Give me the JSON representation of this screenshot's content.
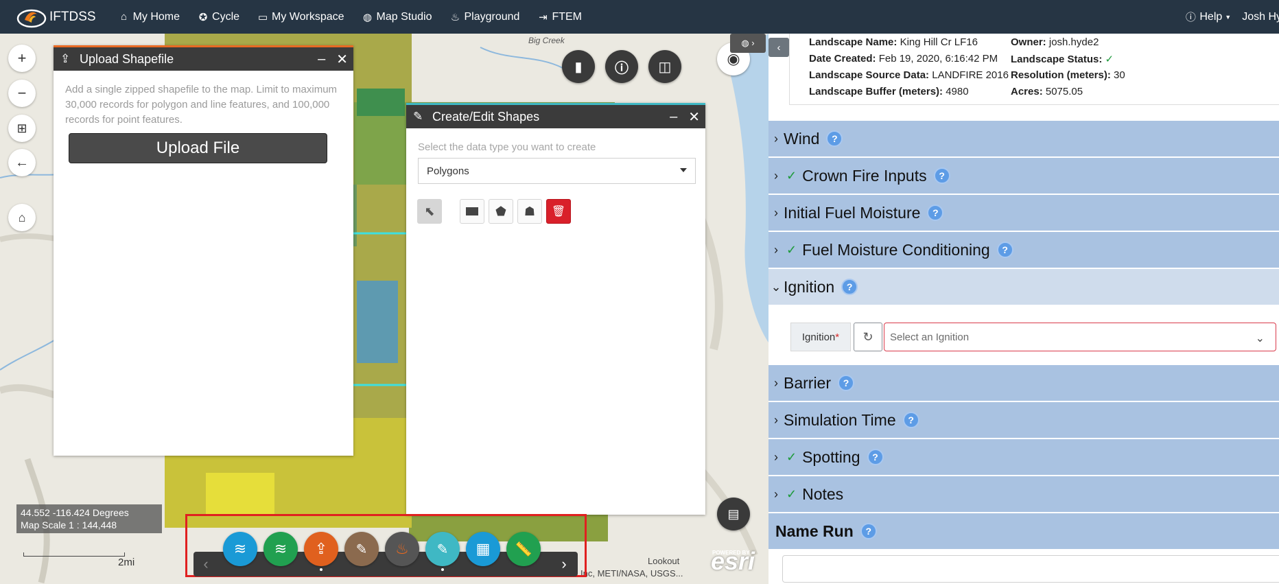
{
  "nav": {
    "brand": "IFTDSS",
    "items": [
      {
        "label": "My Home",
        "icon": "home-icon"
      },
      {
        "label": "Cycle",
        "icon": "cycle-icon"
      },
      {
        "label": "My Workspace",
        "icon": "workspace-icon"
      },
      {
        "label": "Map Studio",
        "icon": "globe-icon"
      },
      {
        "label": "Playground",
        "icon": "fire-icon"
      },
      {
        "label": "FTEM",
        "icon": "export-icon"
      }
    ],
    "help": "Help",
    "user": "Josh Hy"
  },
  "map": {
    "coords": "44.552 -116.424 Degrees",
    "scale": "Map Scale 1 : 144,448",
    "scale_bar_label": "2mi",
    "attribution": "Inc, METI/NASA, USGS...",
    "esri": "esri",
    "esri_sub": "POWERED BY",
    "place_labels": [
      "Big Creek",
      "Lookout"
    ]
  },
  "upload_panel": {
    "title": "Upload Shapefile",
    "description": "Add a single zipped shapefile to the map. Limit to maximum 30,000 records for polygon and line features, and 100,000 records for point features.",
    "button": "Upload File"
  },
  "edit_panel": {
    "title": "Create/Edit Shapes",
    "label": "Select the data type you want to create",
    "selected": "Polygons"
  },
  "toolbar": {
    "buttons": [
      {
        "name": "layers-button",
        "color": "#1a9ad6"
      },
      {
        "name": "add-layer-button",
        "color": "#21a050"
      },
      {
        "name": "upload-button",
        "color": "#e0601e"
      },
      {
        "name": "edit-button",
        "color": "#8b6a4e"
      },
      {
        "name": "fire-button",
        "color": "#555555"
      },
      {
        "name": "draw-button",
        "color": "#3fb8c4"
      },
      {
        "name": "grid-button",
        "color": "#1a9ad6"
      },
      {
        "name": "measure-button",
        "color": "#21a050"
      }
    ]
  },
  "landscape": {
    "name_label": "Landscape Name:",
    "name_value": "King Hill Cr LF16",
    "owner_label": "Owner:",
    "owner_value": "josh.hyde2",
    "created_label": "Date Created:",
    "created_value": "Feb 19, 2020, 6:16:42 PM",
    "status_label": "Landscape Status:",
    "status_value": "✓",
    "source_label": "Landscape Source Data:",
    "source_value": "LANDFIRE 2016",
    "resolution_label": "Resolution (meters):",
    "resolution_value": "30",
    "buffer_label": "Landscape Buffer (meters):",
    "buffer_value": "4980",
    "acres_label": "Acres:",
    "acres_value": "5075.05"
  },
  "sections": [
    {
      "label": "Wind",
      "checked": false,
      "open": false
    },
    {
      "label": "Crown Fire Inputs",
      "checked": true,
      "open": false
    },
    {
      "label": "Initial Fuel Moisture",
      "checked": false,
      "open": false
    },
    {
      "label": "Fuel Moisture Conditioning",
      "checked": true,
      "open": false
    },
    {
      "label": "Ignition",
      "checked": false,
      "open": true
    },
    {
      "label": "Barrier",
      "checked": false,
      "open": false
    },
    {
      "label": "Simulation Time",
      "checked": false,
      "open": false
    },
    {
      "label": "Spotting",
      "checked": true,
      "open": false
    },
    {
      "label": "Notes",
      "checked": true,
      "open": false
    }
  ],
  "ignition": {
    "label": "Ignition",
    "required": "*",
    "placeholder": "Select an Ignition"
  },
  "name_run": {
    "label": "Name Run"
  },
  "help_mark": "?"
}
